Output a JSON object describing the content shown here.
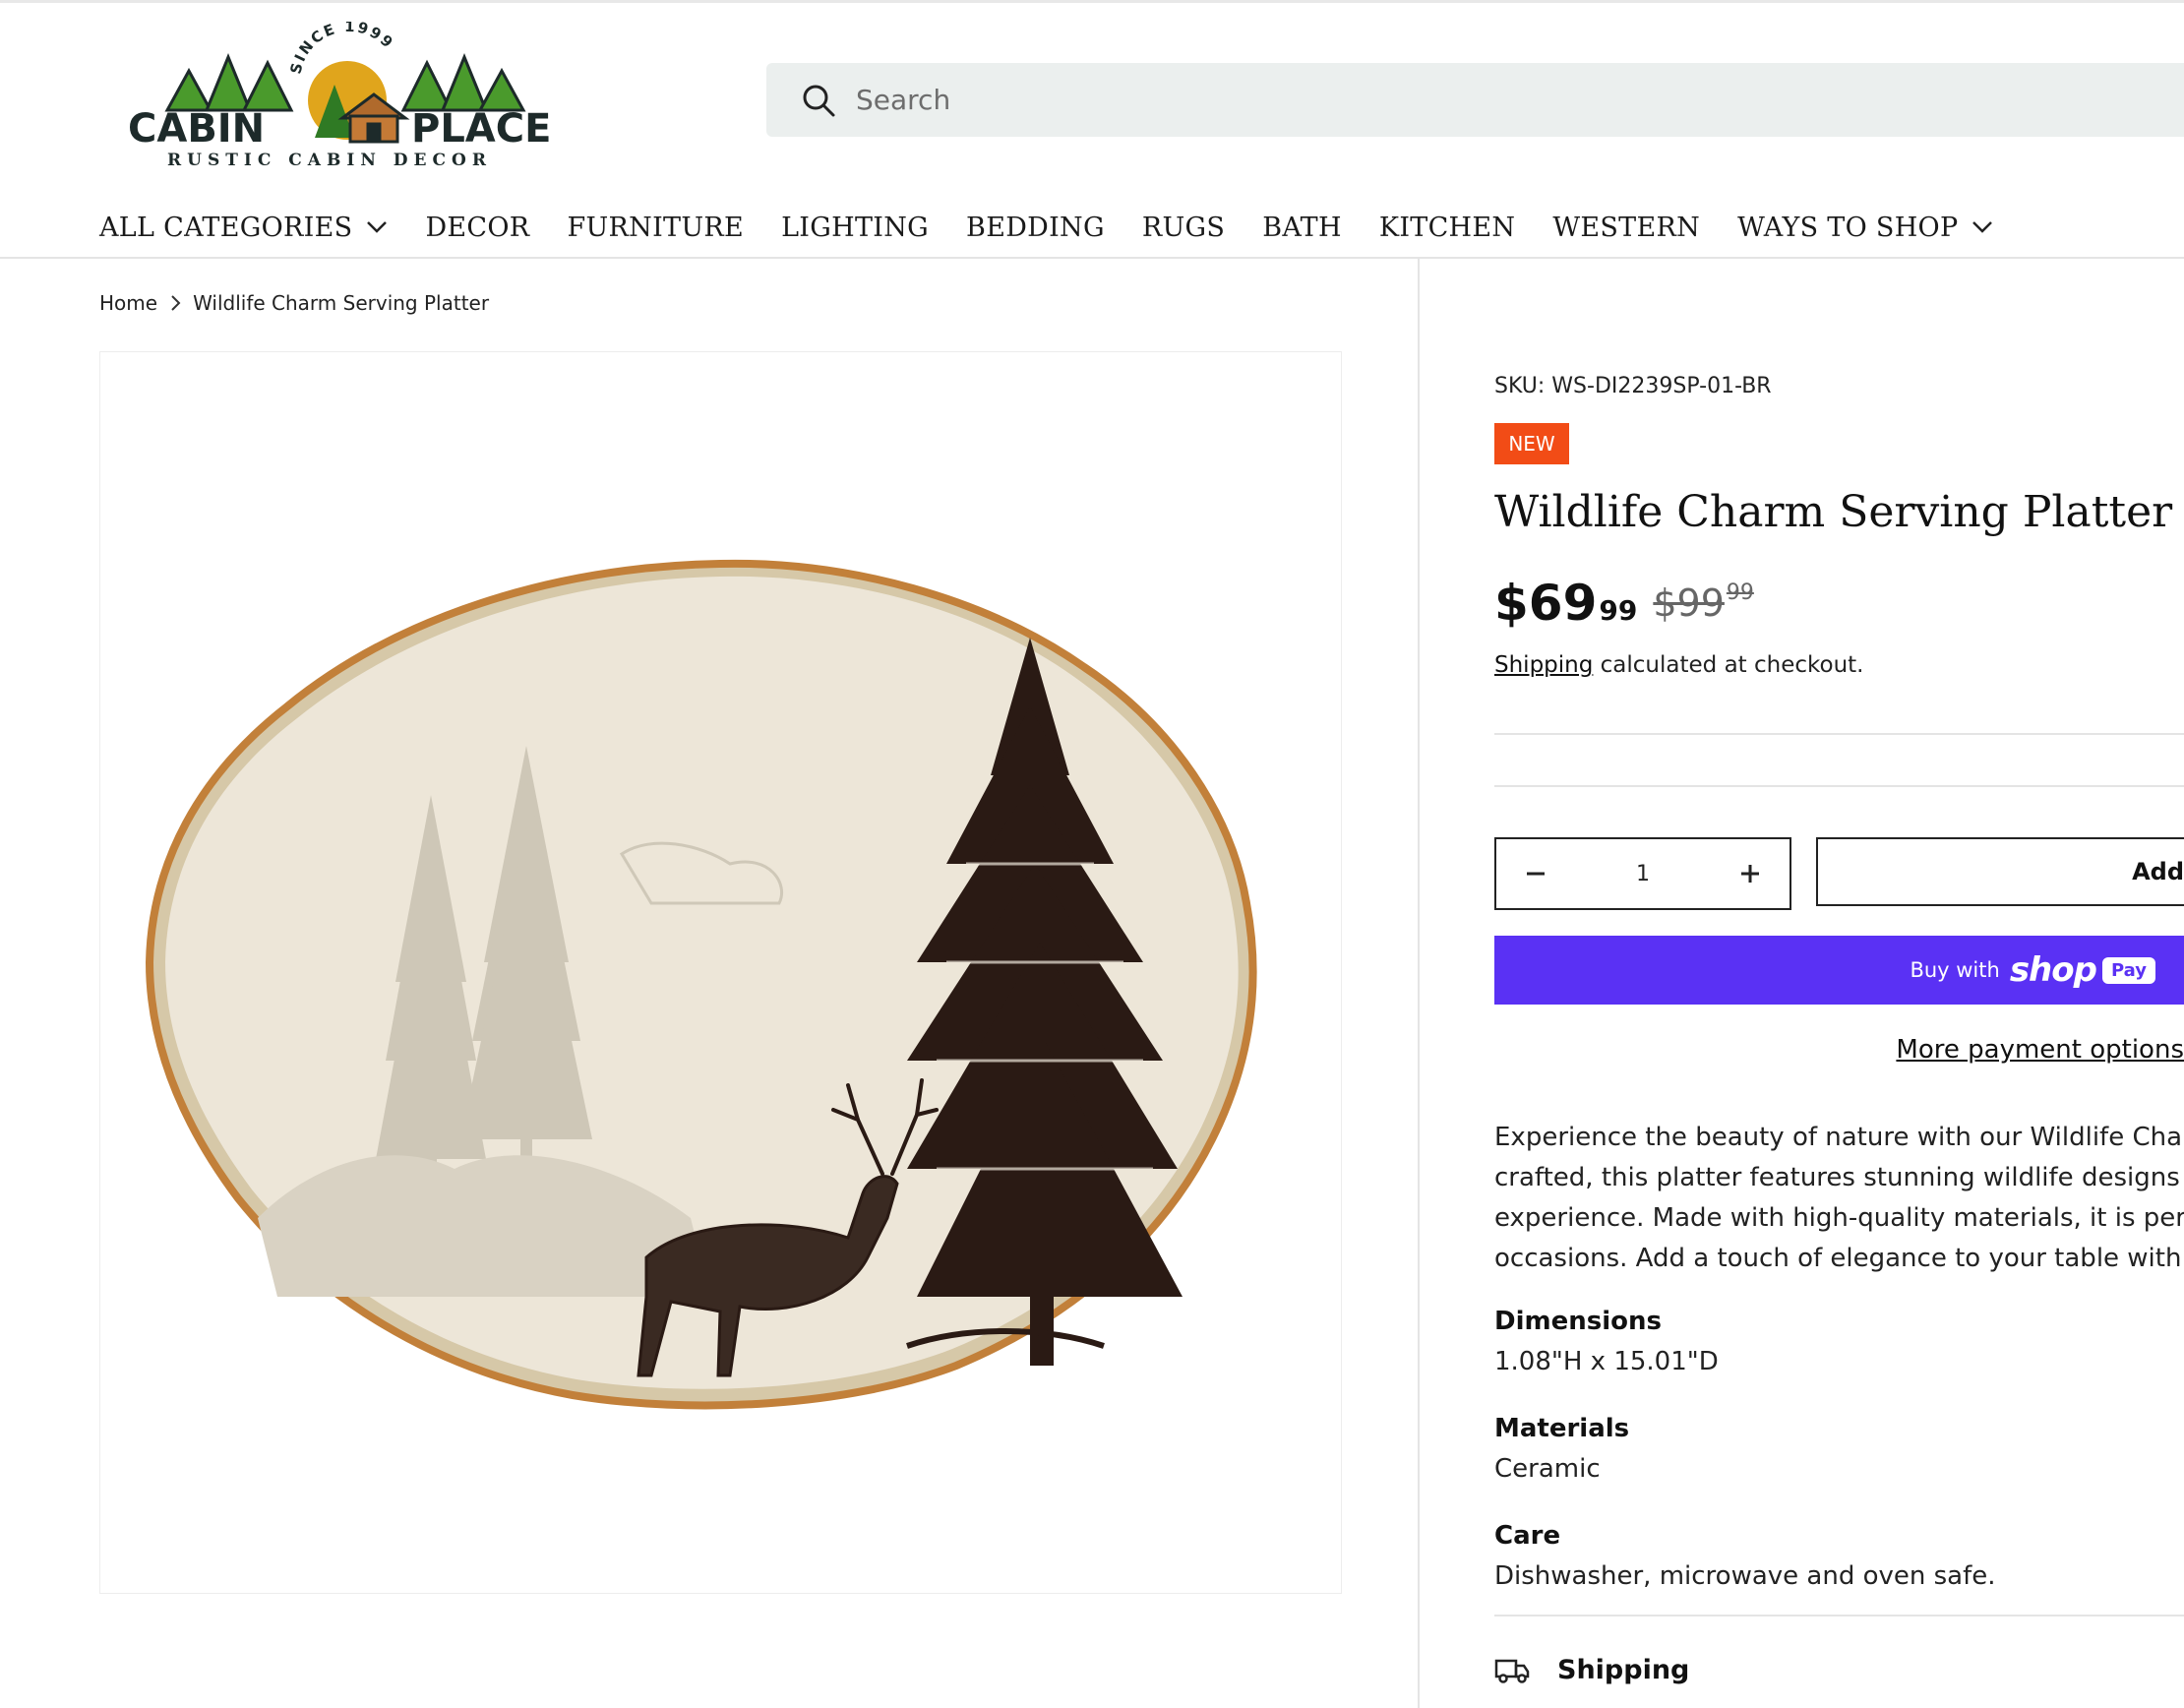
{
  "brand": {
    "since": "SINCE 1999",
    "name_left": "CABIN",
    "name_right": "PLACE",
    "tagline": "RUSTIC CABIN DECOR"
  },
  "search": {
    "placeholder": "Search"
  },
  "nav": {
    "items": [
      {
        "label": "ALL CATEGORIES",
        "dropdown": true
      },
      {
        "label": "DECOR"
      },
      {
        "label": "FURNITURE"
      },
      {
        "label": "LIGHTING"
      },
      {
        "label": "BEDDING"
      },
      {
        "label": "RUGS"
      },
      {
        "label": "BATH"
      },
      {
        "label": "KITCHEN"
      },
      {
        "label": "WESTERN"
      },
      {
        "label": "WAYS TO SHOP",
        "dropdown": true
      }
    ]
  },
  "breadcrumb": {
    "home": "Home",
    "current": "Wildlife Charm Serving Platter"
  },
  "product": {
    "sku": "SKU: WS-DI2239SP-01-BR",
    "badge": "NEW",
    "title": "Wildlife Charm Serving Platter",
    "price_now_whole": "$69",
    "price_now_cents": "99",
    "price_was_whole": "$99",
    "price_was_cents": "99",
    "shipping_link": "Shipping",
    "shipping_rest": " calculated at checkout.",
    "quantity": "1",
    "add_label": "Add",
    "shoppay_prefix": "Buy with",
    "shoppay_brand": "shop",
    "shoppay_pill": "Pay",
    "more_payment": "More payment options",
    "description": [
      "Experience the beauty of nature with our Wildlife Charm",
      "crafted, this platter features stunning wildlife designs th",
      "experience. Made with high-quality materials, it is perfec",
      "occasions. Add a touch of elegance to your table with th"
    ],
    "specs": [
      {
        "heading": "Dimensions",
        "value": "1.08\"H x 15.01\"D"
      },
      {
        "heading": "Materials",
        "value": "Ceramic"
      },
      {
        "heading": "Care",
        "value": "Dishwasher, microwave and oven safe."
      }
    ],
    "shipping_section": "Shipping"
  },
  "colors": {
    "badge": "#f24c16",
    "shoppay": "#5a31f4",
    "search_bg": "#ebefee",
    "logo_green": "#4a9a2c",
    "logo_sun": "#e0a51c"
  },
  "icons": [
    "search-icon",
    "chevron-down-icon",
    "chevron-right-icon",
    "minus-icon",
    "plus-icon",
    "truck-icon"
  ]
}
